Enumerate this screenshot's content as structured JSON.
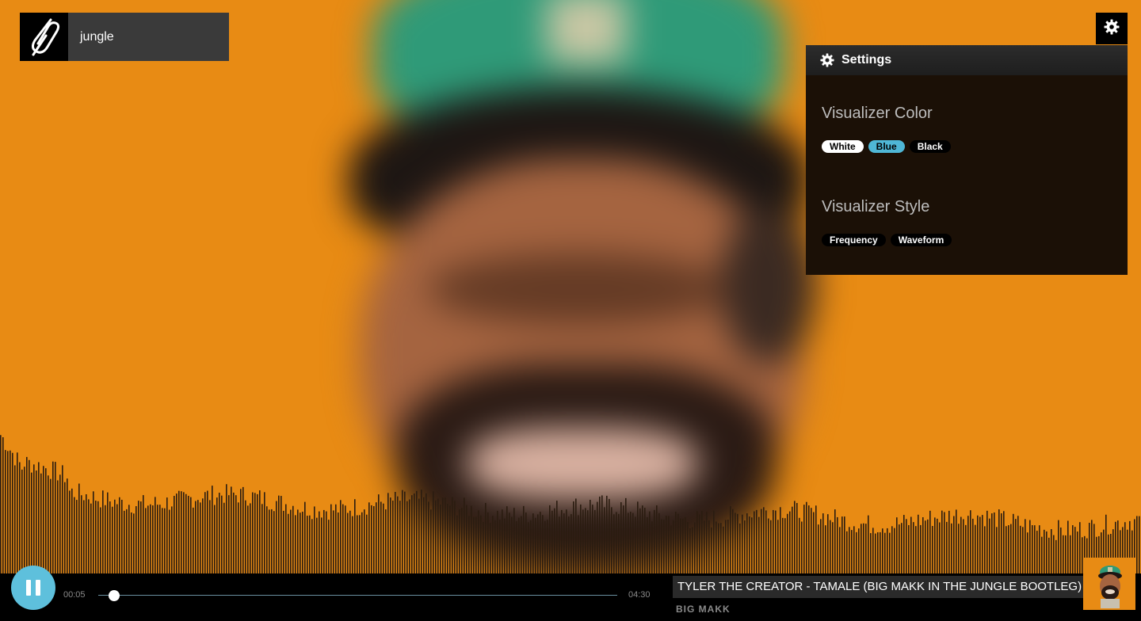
{
  "search": {
    "query": "jungle"
  },
  "icons": {
    "logo": "paperclip-logo-icon",
    "settings": "gear-icon",
    "play_pause": "pause-icon"
  },
  "colors": {
    "background": "#e88b14",
    "accent_blue": "#5ec0dc",
    "panel": "#1b1006",
    "visualizer_bar": "#2a1c10"
  },
  "settings": {
    "title": "Settings",
    "visualizer_color": {
      "label": "Visualizer Color",
      "options": [
        "White",
        "Blue",
        "Black"
      ],
      "selected": "Blue"
    },
    "visualizer_style": {
      "label": "Visualizer Style",
      "options": [
        "Frequency",
        "Waveform"
      ]
    }
  },
  "player": {
    "state": "playing",
    "elapsed": "00:05",
    "duration": "04:30",
    "progress": 0.0185,
    "track_title": "TYLER THE CREATOR - TAMALE (BIG MAKK IN THE JUNGLE BOOTLEG)",
    "artist": "BIG MAKK"
  }
}
